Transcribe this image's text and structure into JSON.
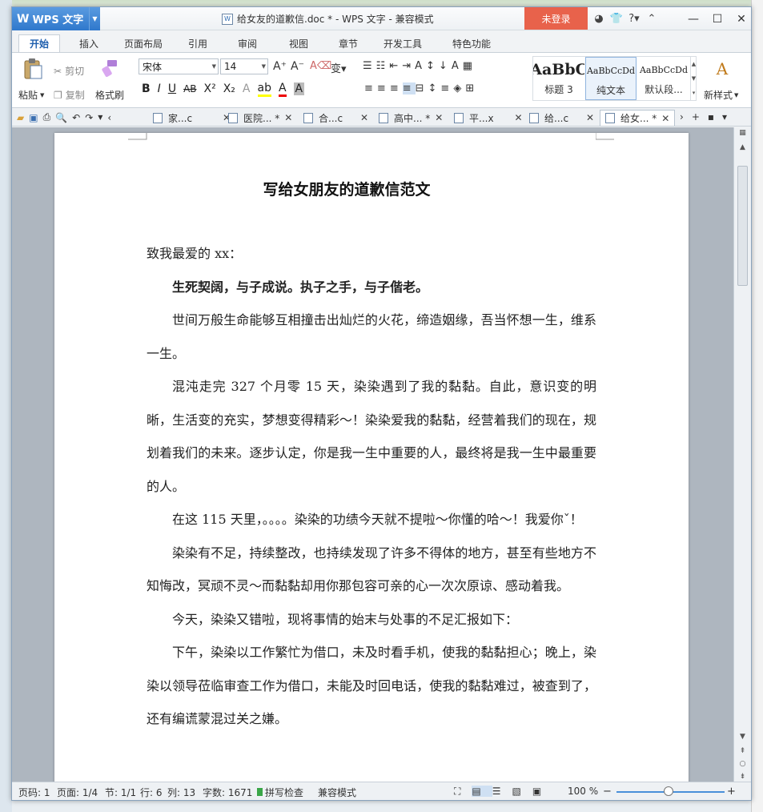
{
  "app": {
    "name": "WPS 文字",
    "window_title": "给女友的道歉信.doc * - WPS 文字 - 兼容模式",
    "login_label": "未登录"
  },
  "ribbon_tabs": [
    "开始",
    "插入",
    "页面布局",
    "引用",
    "审阅",
    "视图",
    "章节",
    "开发工具",
    "特色功能"
  ],
  "ribbon": {
    "paste": "粘贴",
    "cut": "剪切",
    "copy": "复制",
    "format_painter": "格式刷",
    "font_name": "宋体",
    "font_size": "14",
    "styles": [
      {
        "sample": "AaBbC",
        "name": "标题 3"
      },
      {
        "sample": "AaBbCcDd",
        "name": "纯文本"
      },
      {
        "sample": "AaBbCcDd",
        "name": "默认段..."
      }
    ],
    "new_style": "新样式"
  },
  "doc_tabs": [
    "家...c",
    "医院... *",
    "合...c",
    "高中... *",
    "平...x",
    "给...c",
    "给女... *"
  ],
  "document": {
    "heading": "写给女朋友的道歉信范文",
    "paragraphs": [
      {
        "text": "致我最爱的 xx：",
        "style": "noindent"
      },
      {
        "text": "生死契阔，与子成说。执子之手，与子偕老。",
        "style": "bold"
      },
      {
        "text": "世间万般生命能够互相撞击出灿烂的火花，缔造姻缘，吾当怀想一生，维系一生。",
        "style": ""
      },
      {
        "text": "混沌走完 327 个月零 15 天，染染遇到了我的黏黏。自此，意识变的明晰，生活变的充实，梦想变得精彩～！染染爱我的黏黏，经营着我们的现在，规划着我们的未来。逐步认定，你是我一生中重要的人，最终将是我一生中最重要的人。",
        "style": ""
      },
      {
        "text": "在这 115 天里，。。。。染染的功绩今天就不提啦～你懂的哈～！我爱你ˇ！",
        "style": ""
      },
      {
        "text": "染染有不足，持续整改，也持续发现了许多不得体的地方，甚至有些地方不知悔改，冥顽不灵～而黏黏却用你那包容可亲的心一次次原谅、感动着我。",
        "style": ""
      },
      {
        "text": "今天，染染又错啦，现将事情的始末与处事的不足汇报如下：",
        "style": ""
      },
      {
        "text": "下午，染染以工作繁忙为借口，未及时看手机，使我的黏黏担心；晚上，染染以领导莅临审查工作为借口，未能及时回电话，使我的黏黏难过，被查到了，还有编谎蒙混过关之嫌。",
        "style": ""
      }
    ]
  },
  "status": {
    "page_code": "页码: 1",
    "pages": "页面: 1/4",
    "section": "节: 1/1",
    "row": "行: 6",
    "col": "列: 13",
    "word_count": "字数: 1671",
    "spell_check": "拼写检查",
    "compat_mode": "兼容模式",
    "zoom": "100 %"
  },
  "colors": {
    "brand_blue": "#2f78cc",
    "login_red": "#e8624b"
  }
}
